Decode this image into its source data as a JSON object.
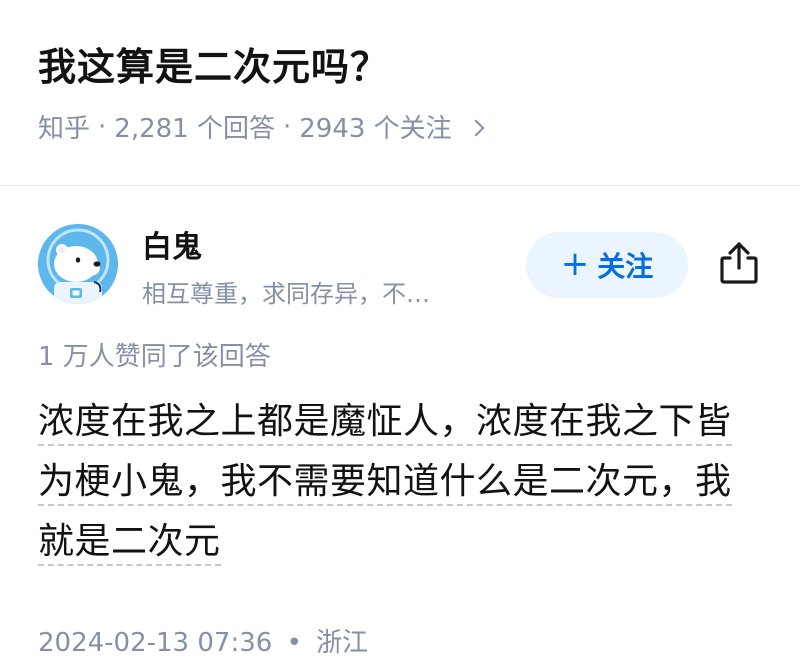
{
  "question": {
    "title": "我这算是二次元吗？",
    "source": "知乎",
    "sep1": "·",
    "answer_count": "2,281 个回答",
    "sep2": "·",
    "follower_count": "2943 个关注",
    "chevron_icon": "chevron-right-icon"
  },
  "author": {
    "name": "白鬼",
    "bio": "相互尊重，求同存异，不…",
    "avatar_icon": "polar-bear-astronaut-avatar",
    "follow_label": "关注",
    "follow_icon": "plus-icon",
    "share_icon": "share-icon",
    "accent_color": "#056de8",
    "follow_bg": "#ebf5ff"
  },
  "answer": {
    "upvote_text": "1 万人赞同了该回答",
    "content_line1": "浓度在我之上都是魔怔人，浓度在我之下皆",
    "content_line2": "为梗小鬼，我不需要知道什么是二次元，我",
    "content_line3": "就是二次元",
    "timestamp": "2024-02-13 07:36",
    "meta_sep": "•",
    "location": "浙江"
  }
}
